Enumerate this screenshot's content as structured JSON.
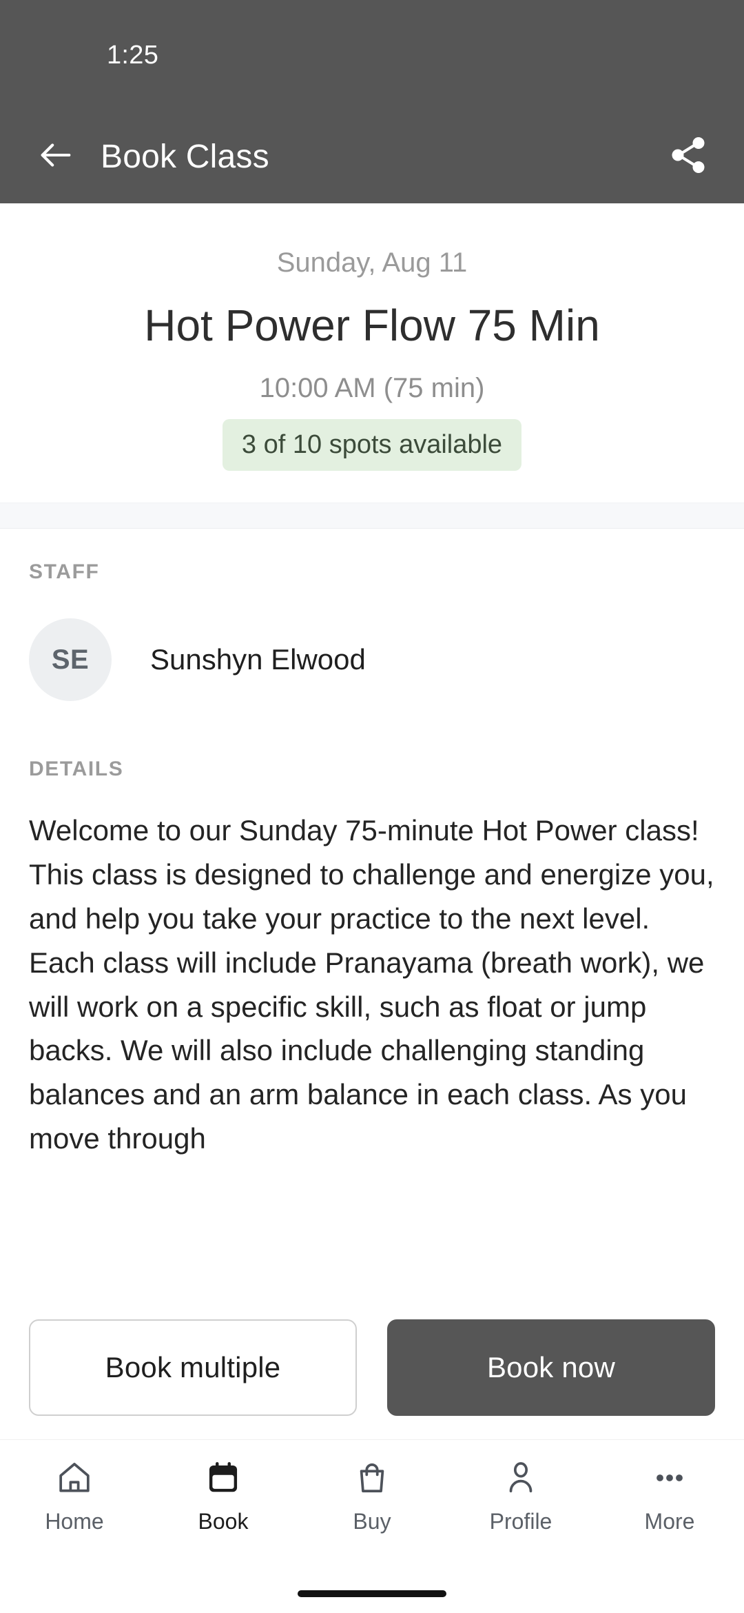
{
  "status_bar": {
    "time": "1:25"
  },
  "app_bar": {
    "title": "Book Class",
    "back_icon": "back-arrow-icon",
    "share_icon": "share-icon"
  },
  "class_header": {
    "date": "Sunday, Aug 11",
    "title": "Hot Power Flow 75 Min",
    "time": "10:00 AM (75 min)",
    "availability": "3 of 10 spots available",
    "availability_bg": "#e3f0e0",
    "availability_text_color": "#3c4b3a"
  },
  "staff": {
    "label": "STAFF",
    "initials": "SE",
    "name": "Sunshyn Elwood"
  },
  "details": {
    "label": "DETAILS",
    "text": "Welcome to our Sunday 75-minute Hot Power class! This class is designed to challenge and energize you, and help you take your practice to the next level.   Each class will include Pranayama (breath work), we will work on a specific skill, such as float or jump backs. We will also include challenging standing balances and an arm balance in each class.   As you move through"
  },
  "actions": {
    "secondary_label": "Book multiple",
    "primary_label": "Book now",
    "primary_bg": "#565656"
  },
  "bottom_nav": {
    "items": [
      {
        "label": "Home",
        "icon": "home-icon",
        "active": false
      },
      {
        "label": "Book",
        "icon": "calendar-icon",
        "active": true
      },
      {
        "label": "Buy",
        "icon": "shopping-bag-icon",
        "active": false
      },
      {
        "label": "Profile",
        "icon": "person-icon",
        "active": false
      },
      {
        "label": "More",
        "icon": "more-dots-icon",
        "active": false
      }
    ]
  },
  "theme": {
    "app_bar_bg": "#565656",
    "page_bg": "#ffffff",
    "divider_bg": "#f7f8fa"
  }
}
